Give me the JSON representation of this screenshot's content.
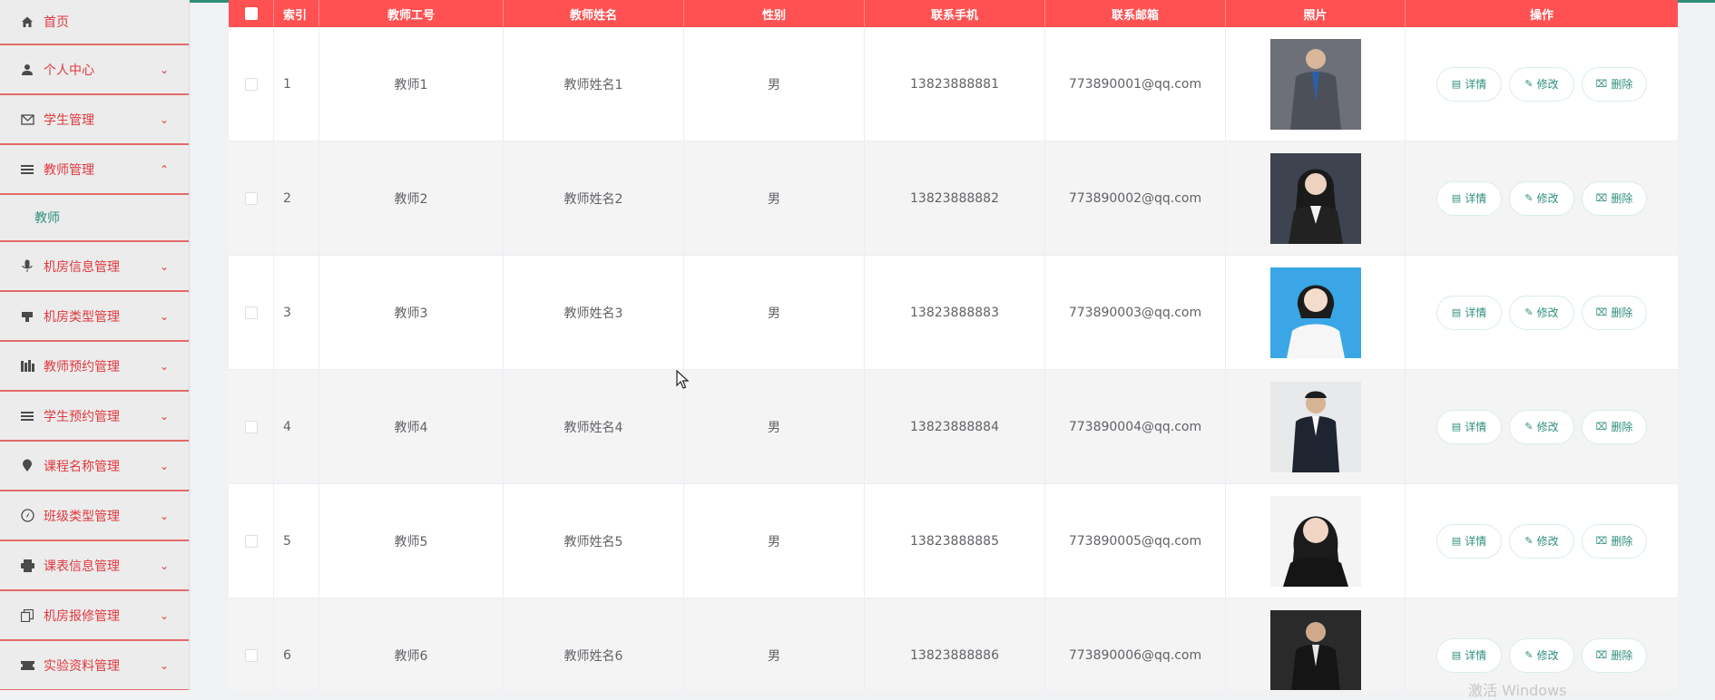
{
  "sidebar": {
    "items": [
      {
        "label": "首页",
        "icon": "home-icon",
        "arrow": ""
      },
      {
        "label": "个人中心",
        "icon": "user-icon",
        "arrow": "⌄"
      },
      {
        "label": "学生管理",
        "icon": "mail-icon",
        "arrow": "⌄"
      },
      {
        "label": "教师管理",
        "icon": "list-icon",
        "arrow": "⌃"
      },
      {
        "label": "机房信息管理",
        "icon": "mic-icon",
        "arrow": "⌄"
      },
      {
        "label": "机房类型管理",
        "icon": "desk-icon",
        "arrow": "⌄"
      },
      {
        "label": "教师预约管理",
        "icon": "bars-icon",
        "arrow": "⌄"
      },
      {
        "label": "学生预约管理",
        "icon": "list-icon",
        "arrow": "⌄"
      },
      {
        "label": "课程名称管理",
        "icon": "pin-icon",
        "arrow": "⌄"
      },
      {
        "label": "班级类型管理",
        "icon": "compass-icon",
        "arrow": "⌄"
      },
      {
        "label": "课表信息管理",
        "icon": "printer-icon",
        "arrow": "⌄"
      },
      {
        "label": "机房报修管理",
        "icon": "copy-icon",
        "arrow": "⌄"
      },
      {
        "label": "实验资料管理",
        "icon": "ticket-icon",
        "arrow": "⌄"
      }
    ],
    "submenu_label": "教师"
  },
  "table": {
    "headers": [
      "索引",
      "教师工号",
      "教师姓名",
      "性别",
      "联系手机",
      "联系邮箱",
      "照片",
      "操作"
    ],
    "rows": [
      {
        "index": "1",
        "id": "教师1",
        "name": "教师姓名1",
        "gender": "男",
        "phone": "13823888881",
        "email": "773890001@qq.com"
      },
      {
        "index": "2",
        "id": "教师2",
        "name": "教师姓名2",
        "gender": "男",
        "phone": "13823888882",
        "email": "773890002@qq.com"
      },
      {
        "index": "3",
        "id": "教师3",
        "name": "教师姓名3",
        "gender": "男",
        "phone": "13823888883",
        "email": "773890003@qq.com"
      },
      {
        "index": "4",
        "id": "教师4",
        "name": "教师姓名4",
        "gender": "男",
        "phone": "13823888884",
        "email": "773890004@qq.com"
      },
      {
        "index": "5",
        "id": "教师5",
        "name": "教师姓名5",
        "gender": "男",
        "phone": "13823888885",
        "email": "773890005@qq.com"
      },
      {
        "index": "6",
        "id": "教师6",
        "name": "教师姓名6",
        "gender": "男",
        "phone": "13823888886",
        "email": "773890006@qq.com"
      }
    ],
    "actions": {
      "detail": "详情",
      "edit": "修改",
      "delete": "删除"
    }
  },
  "watermark": "激活 Windows",
  "colors": {
    "header_bg": "#ff5152",
    "accent": "#2f8f7d",
    "menu_text": "#e0393e"
  }
}
